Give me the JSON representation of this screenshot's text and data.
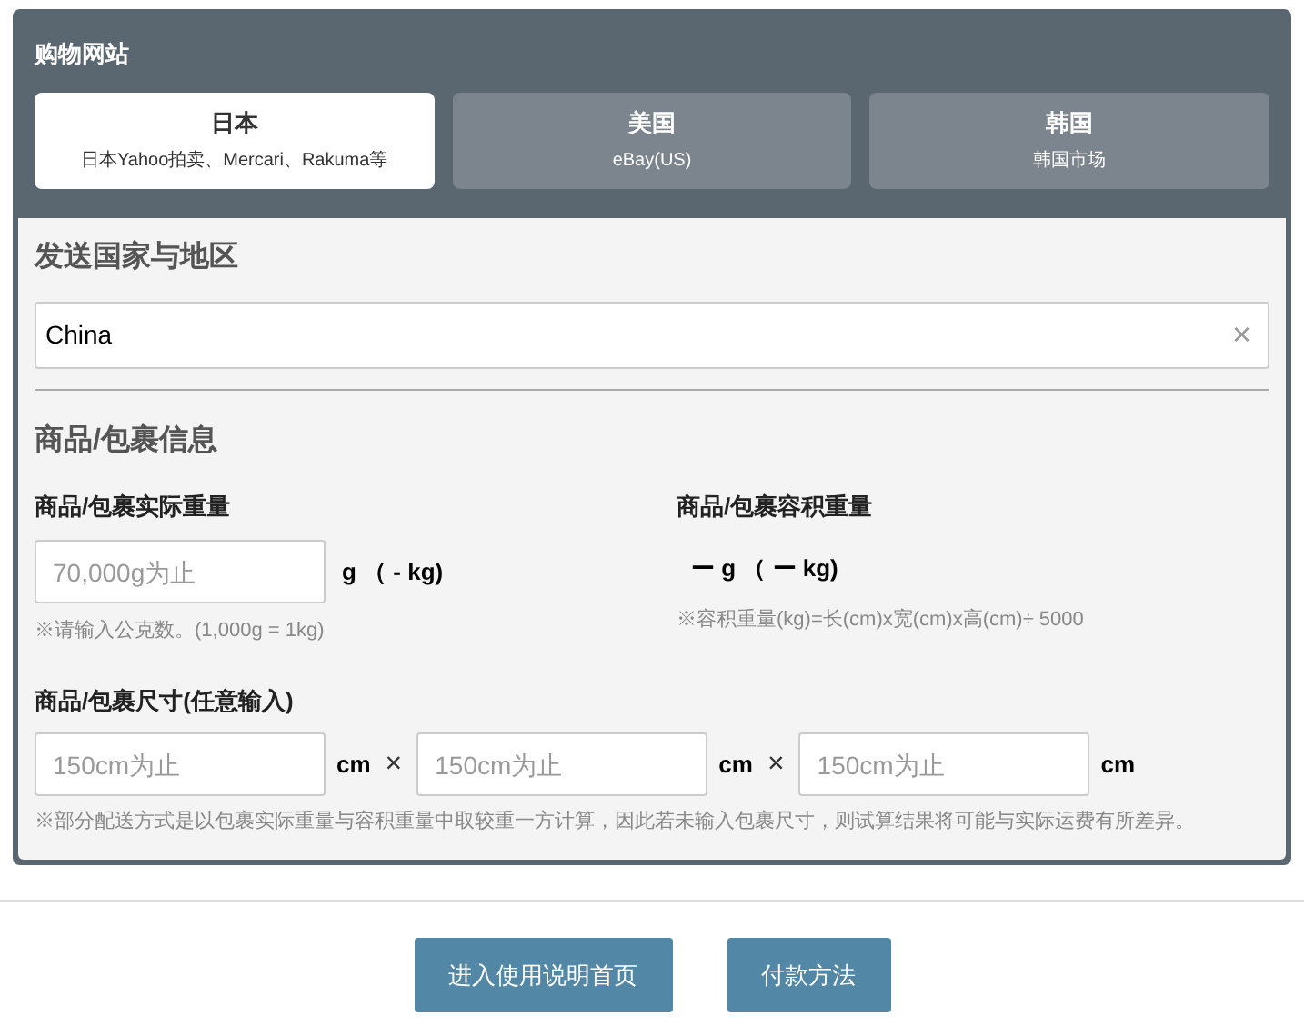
{
  "panel_title": "购物网站",
  "tabs": [
    {
      "label": "日本",
      "sublabel": "日本Yahoo拍卖、Mercari、Rakuma等",
      "selected": true
    },
    {
      "label": "美国",
      "sublabel": "eBay(US)",
      "selected": false
    },
    {
      "label": "韩国",
      "sublabel": "韩国市场",
      "selected": false
    }
  ],
  "destination": {
    "heading": "发送国家与地区",
    "value": "China",
    "clear": "×"
  },
  "package": {
    "heading": "商品/包裹信息",
    "actual_weight": {
      "label": "商品/包裹实际重量",
      "placeholder": "70,000g为止",
      "unit": "g （ - kg)",
      "note": "※请输入公克数。(1,000g = 1kg)"
    },
    "volumetric_weight": {
      "label": "商品/包裹容积重量",
      "value": "ー g （ ー kg)",
      "note": "※容积重量(kg)=长(cm)x宽(cm)x高(cm)÷ 5000"
    },
    "dimensions": {
      "label": "商品/包裹尺寸(任意输入)",
      "fields": [
        {
          "placeholder": "150cm为止",
          "unit": "cm"
        },
        {
          "placeholder": "150cm为止",
          "unit": "cm"
        },
        {
          "placeholder": "150cm为止",
          "unit": "cm"
        }
      ],
      "separator": "×",
      "note": "※部分配送方式是以包裹实际重量与容积重量中取较重一方计算，因此若未输入包裹尺寸，则试算结果将可能与实际运费有所差异。"
    }
  },
  "buttons": [
    "进入使用说明首页",
    "付款方法"
  ]
}
